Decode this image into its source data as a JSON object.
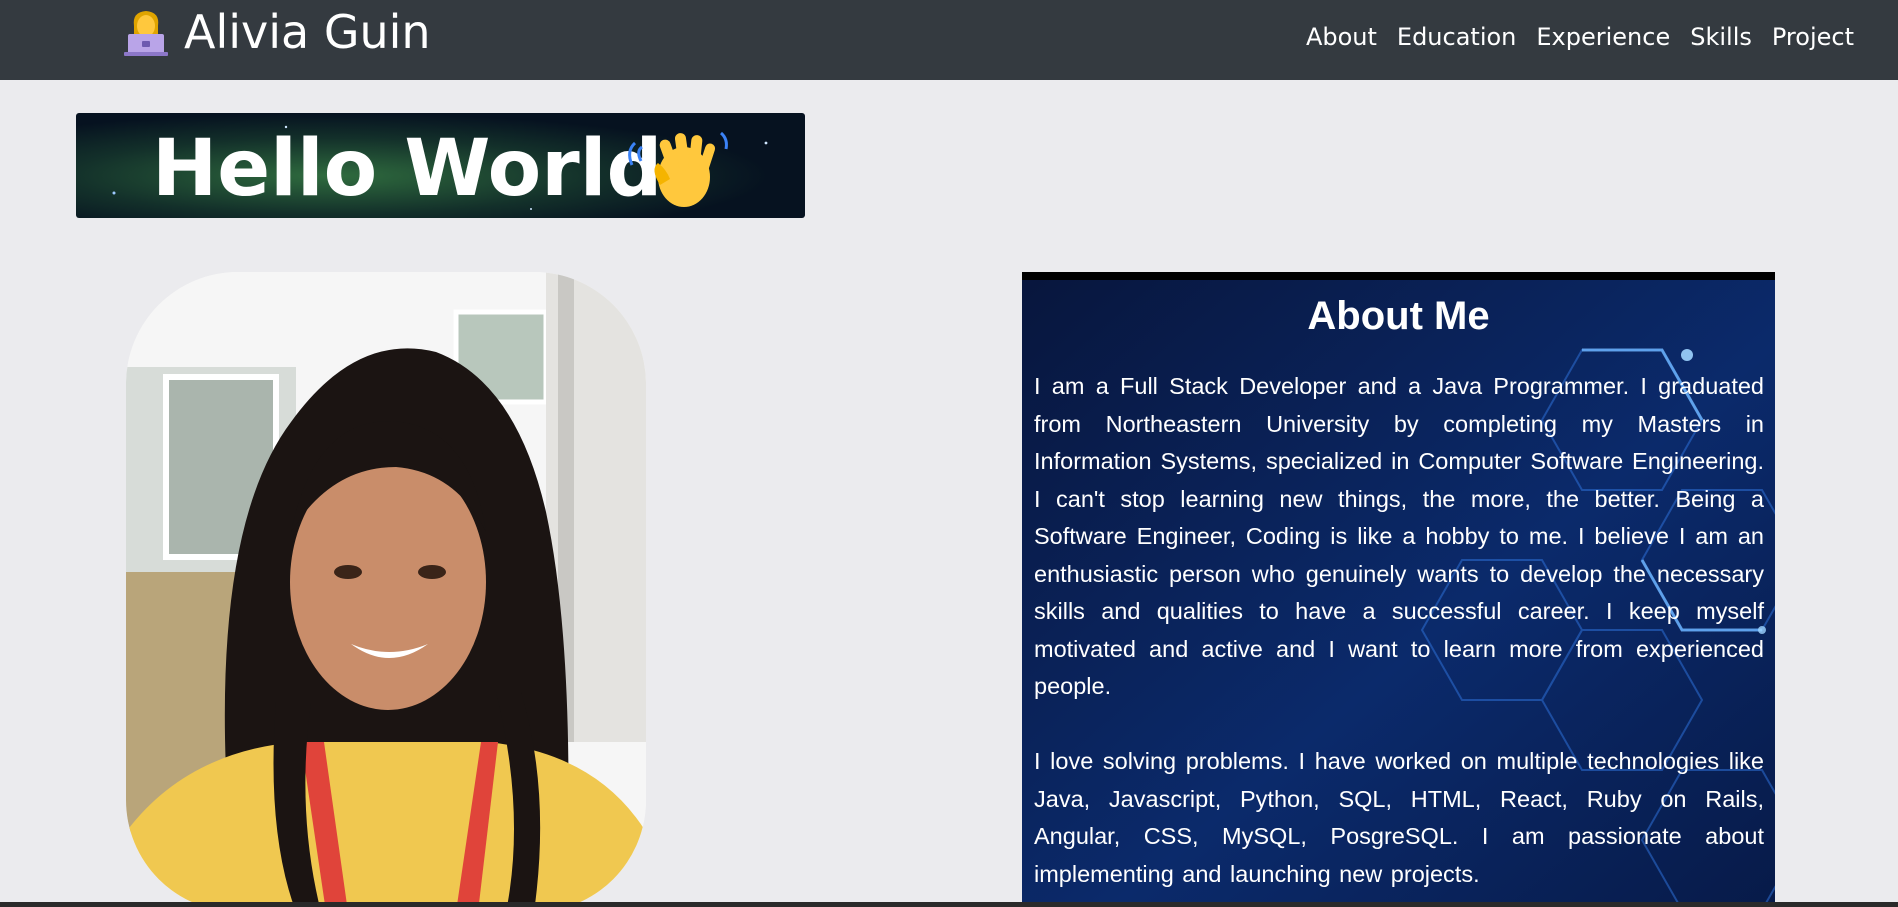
{
  "navbar": {
    "brand": "Alivia Guin",
    "brand_icon": "woman-technologist-icon",
    "links": [
      "About",
      "Education",
      "Experience",
      "Skills",
      "Project"
    ],
    "background": "#343a40"
  },
  "banner": {
    "text": "Hello World",
    "icon": "waving-hand-icon"
  },
  "about": {
    "title": "About Me",
    "paragraphs": [
      "I am a Full Stack Developer and a Java Programmer. I graduated from Northeastern University by completing my Masters in Information Systems, specialized in Computer Software Engineering. I can't stop learning new things, the more, the better. Being a Software Engineer, Coding is like a hobby to me. I believe I am an enthusiastic person who genuinely wants to develop the necessary skills and qualities to have a successful career. I keep myself motivated and active and I want to learn more from experienced people.",
      "I love solving problems. I have worked on multiple technologies like Java, Javascript, Python, SQL, HTML, React, Ruby on Rails, Angular, CSS, MySQL, PosgreSQL. I am passionate about implementing and launching new projects."
    ],
    "background": "#061a45"
  },
  "page": {
    "background": "#ebebee"
  }
}
